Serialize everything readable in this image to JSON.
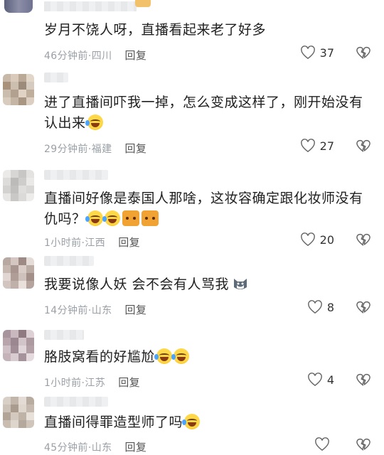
{
  "comments": [
    {
      "text": "岁月不饶人呀，直播看起来老了好多",
      "time": "46分钟前",
      "location": "四川",
      "reply_label": "回复",
      "likes": "37",
      "emojis": []
    },
    {
      "text": "进了直播间吓我一掉，怎么变成这样了，刚开始没有认出来",
      "time": "29分钟前",
      "location": "福建",
      "reply_label": "回复",
      "likes": "27",
      "emojis": [
        "laugh-cry"
      ]
    },
    {
      "text": "直播间好像是泰国人那啥，这妆容确定跟化妆师没有仇吗？",
      "time": "1小时前",
      "location": "江西",
      "reply_label": "回复",
      "likes": "20",
      "emojis": [
        "laugh-cry",
        "laugh-cry",
        "cat",
        "cat"
      ]
    },
    {
      "text": "我要说像人妖 会不会有人骂我",
      "time": "14分钟前",
      "location": "山东",
      "reply_label": "回复",
      "likes": "8",
      "emojis": [
        "husky"
      ]
    },
    {
      "text": "胳肢窝看的好尴尬",
      "time": "1小时前",
      "location": "江苏",
      "reply_label": "回复",
      "likes": "4",
      "emojis": [
        "laugh-cry",
        "laugh-cry"
      ]
    },
    {
      "text": "直播间得罪造型师了吗",
      "time": "45分钟前",
      "location": "山东",
      "reply_label": "回复",
      "likes": "",
      "emojis": [
        "laugh-cry"
      ]
    }
  ],
  "separator": "·",
  "colors": {
    "meta": "#9aa0a6",
    "text": "#1f1f1f",
    "icon": "#555555"
  },
  "icons": {
    "like": "heart-outline-icon",
    "dislike": "broken-heart-icon"
  }
}
